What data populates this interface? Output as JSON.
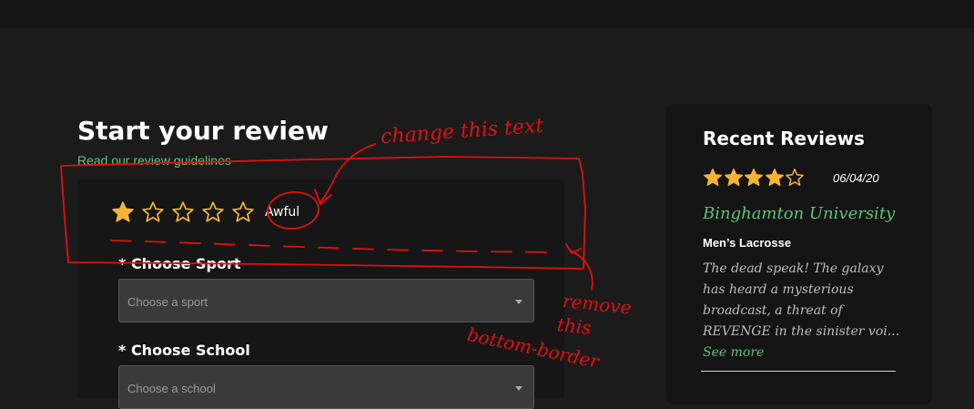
{
  "review": {
    "title": "Start your review",
    "guidelines_link": "Read our review guidelines",
    "rating": 1,
    "rating_max": 5,
    "rating_label": "Awful",
    "fields": [
      {
        "label": "* Choose Sport",
        "placeholder": "Choose a sport"
      },
      {
        "label": "* Choose School",
        "placeholder": "Choose a school"
      }
    ]
  },
  "recent": {
    "title": "Recent Reviews",
    "rating": 4,
    "rating_max": 5,
    "date": "06/04/20",
    "school": "Binghamton University",
    "sport": "Men’s Lacrosse",
    "excerpt": "The dead speak! The galaxy has heard a mysterious broadcast, a threat of REVENGE in the sinister voi...",
    "see_more": "See more"
  },
  "annotations": {
    "note_text": "change this text",
    "note_border_1": "remove",
    "note_border_2": "this",
    "note_border_3": "bottom-border"
  },
  "colors": {
    "star": "#f5b432",
    "accent": "#5fc17b",
    "annotation": "#e01010"
  }
}
